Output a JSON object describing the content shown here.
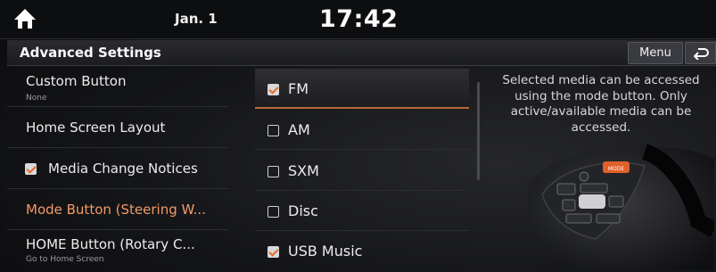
{
  "status_bar": {
    "date": "Jan. 1",
    "time": "17:42"
  },
  "header": {
    "title": "Advanced Settings",
    "menu_label": "Menu"
  },
  "left_menu": [
    {
      "label": "Custom Button",
      "sub": "None"
    },
    {
      "label": "Home Screen Layout"
    },
    {
      "label": "Media Change Notices",
      "checked": true
    },
    {
      "label": "Mode Button (Steering W...",
      "active": true
    },
    {
      "label": "HOME Button (Rotary C...",
      "sub": "Go to Home Screen"
    }
  ],
  "media_options": [
    {
      "label": "FM",
      "checked": true
    },
    {
      "label": "AM",
      "checked": false
    },
    {
      "label": "SXM",
      "checked": false
    },
    {
      "label": "Disc",
      "checked": false
    },
    {
      "label": "USB Music",
      "checked": true
    }
  ],
  "description": "Selected media can be accessed using the mode button. Only active/available media can be accessed.",
  "illustration": {
    "mode_key_label": "MODE"
  },
  "colors": {
    "accent": "#f29a68",
    "focus_line": "#b8683a",
    "mode_key": "#e0602a"
  }
}
